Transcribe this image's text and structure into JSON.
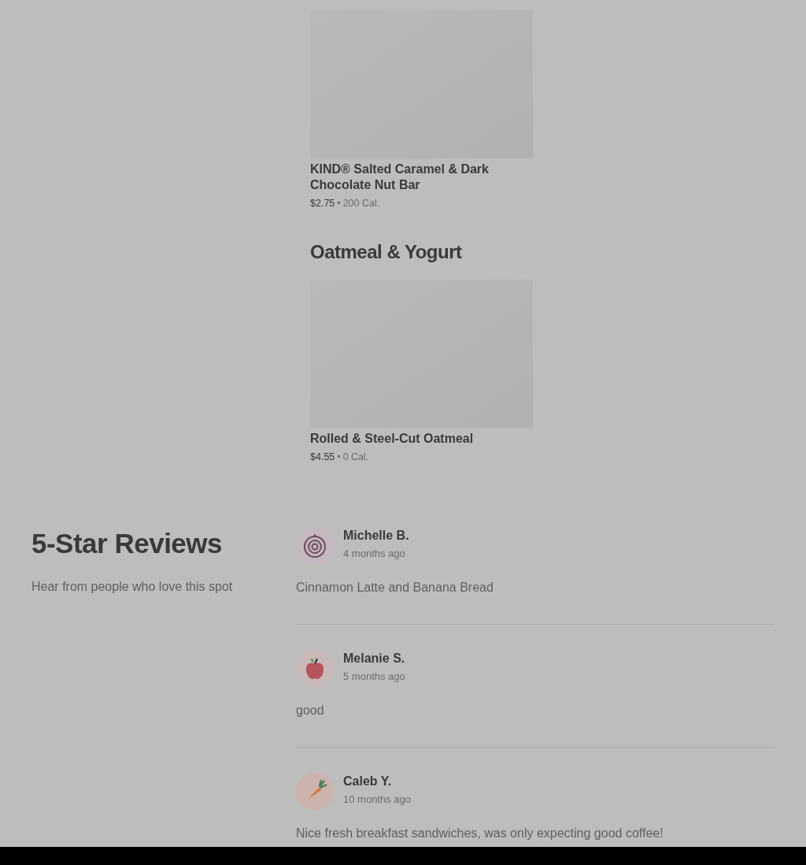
{
  "menu_sections": [
    {
      "items": [
        {
          "name": "KIND® Salted Caramel & Dark Chocolate Nut Bar",
          "price": "$2.75",
          "separator": "•",
          "calories": "200 Cal."
        }
      ]
    },
    {
      "heading": "Oatmeal & Yogurt",
      "items": [
        {
          "name": "Rolled & Steel-Cut Oatmeal",
          "price": "$4.55",
          "separator": "•",
          "calories": "0 Cal."
        }
      ]
    }
  ],
  "reviews_section": {
    "title": "5-Star Reviews",
    "subtitle": "Hear from people who love this spot",
    "reviews": [
      {
        "author": "Michelle B.",
        "time": "4 months ago",
        "text": "Cinnamon Latte and Banana Bread",
        "kind": "onion"
      },
      {
        "author": "Melanie S.",
        "time": "5 months ago",
        "text": "good",
        "kind": "apple"
      },
      {
        "author": "Caleb Y.",
        "time": "10 months ago",
        "text": "Nice fresh breakfast sandwiches, was only expecting good coffee!",
        "kind": "carrot"
      }
    ]
  }
}
